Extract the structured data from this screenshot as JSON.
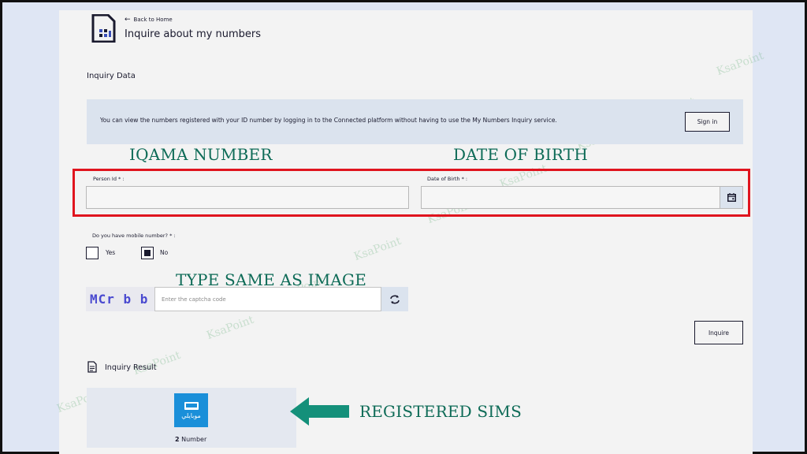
{
  "header": {
    "back_label": "Back to Home",
    "title": "Inquire about my numbers"
  },
  "inquiry_data": {
    "section_label": "Inquiry Data",
    "info_text": "You can view the numbers registered with your ID number by logging in to the Connected platform without having to use the My Numbers Inquiry service.",
    "signin_label": "Sign in"
  },
  "annotations": {
    "iqama": "IQAMA NUMBER",
    "dob": "DATE OF BIRTH",
    "captcha": "TYPE SAME AS IMAGE",
    "sims": "REGISTERED SIMS"
  },
  "form": {
    "person_id_label": "Person Id * :",
    "dob_label": "Date of Birth * :",
    "mobile_question": "Do you have mobile number? * :",
    "option_yes": "Yes",
    "option_no": "No",
    "captcha_text": "MCr b b",
    "captcha_placeholder": "Enter the captcha code",
    "inquire_label": "Inquire"
  },
  "result": {
    "label": "Inquiry Result",
    "operator_logo_text": "موبايلي",
    "count_value": "2",
    "count_unit": "Number"
  },
  "watermark": "KsaPoint",
  "colors": {
    "accent_dark": "#1a1a2e",
    "highlight_red": "#e0141e",
    "annotation_green": "#0e6b57",
    "info_box": "#dbe3ee",
    "operator_blue": "#1a8fd9"
  }
}
